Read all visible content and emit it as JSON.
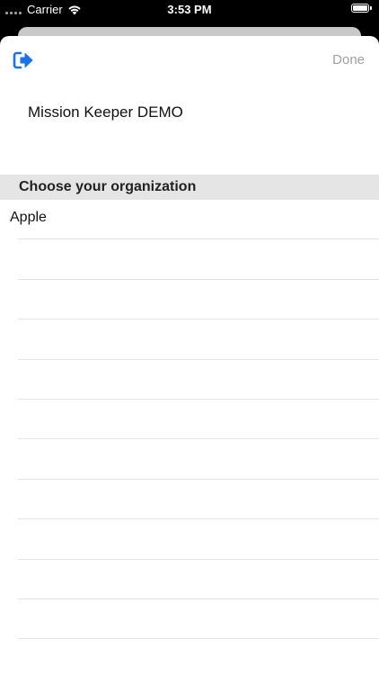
{
  "status_bar": {
    "carrier": "Carrier",
    "time": "3:53 PM",
    "battery_level": 1.0
  },
  "nav": {
    "left_icon": "logout-arrow-icon",
    "done_label": "Done",
    "accent_color": "#1a73e8",
    "done_color": "#9e9ea3"
  },
  "app_title": "Mission Keeper DEMO",
  "section": {
    "header": "Choose your organization"
  },
  "organizations": [
    {
      "label": "Apple"
    },
    {
      "label": ""
    },
    {
      "label": ""
    },
    {
      "label": ""
    },
    {
      "label": ""
    },
    {
      "label": ""
    },
    {
      "label": ""
    },
    {
      "label": ""
    },
    {
      "label": ""
    },
    {
      "label": ""
    },
    {
      "label": ""
    },
    {
      "label": ""
    }
  ]
}
